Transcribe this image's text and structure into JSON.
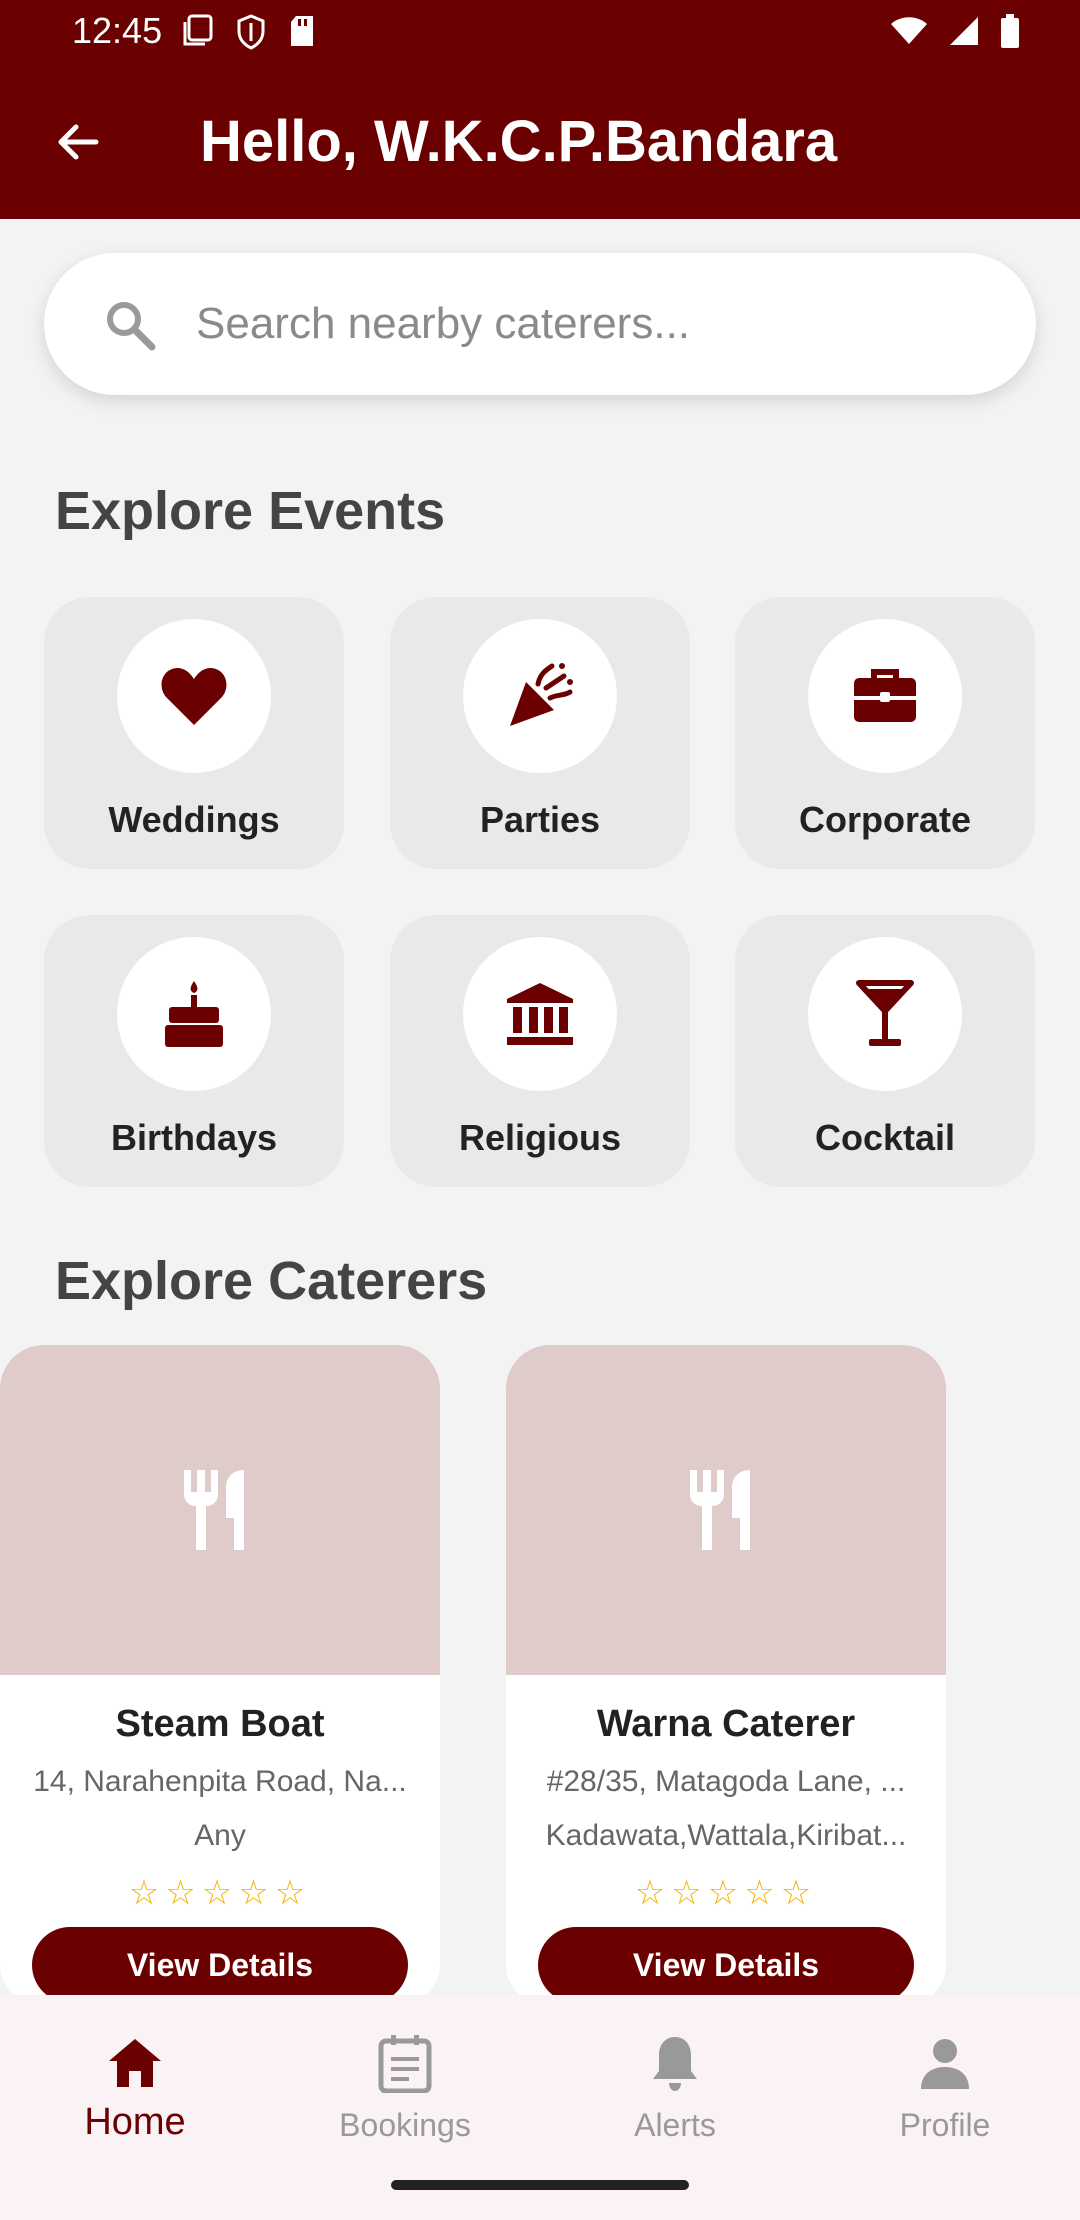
{
  "status_bar": {
    "time": "12:45"
  },
  "header": {
    "title": "Hello, W.K.C.P.Bandara"
  },
  "search": {
    "placeholder": "Search nearby caterers..."
  },
  "sections": {
    "events_title": "Explore Events",
    "caterers_title": "Explore Caterers"
  },
  "events": [
    {
      "label": "Weddings",
      "icon": "heart-icon"
    },
    {
      "label": "Parties",
      "icon": "party-popper-icon"
    },
    {
      "label": "Corporate",
      "icon": "briefcase-icon"
    },
    {
      "label": "Birthdays",
      "icon": "cake-icon"
    },
    {
      "label": "Religious",
      "icon": "temple-icon"
    },
    {
      "label": "Cocktail",
      "icon": "cocktail-icon"
    }
  ],
  "caterers": [
    {
      "name": "Steam Boat",
      "address": "14, Narahenpita Road, Na...",
      "area": "Any",
      "rating": 0,
      "stars": "☆☆☆☆☆",
      "button_label": "View Details"
    },
    {
      "name": "Warna Caterer",
      "address": "#28/35, Matagoda Lane, ...",
      "area": "Kadawata,Wattala,Kiribat...",
      "rating": 0,
      "stars": "☆☆☆☆☆",
      "button_label": "View Details"
    }
  ],
  "bottom_nav": [
    {
      "label": "Home",
      "icon": "home-icon",
      "active": true
    },
    {
      "label": "Bookings",
      "icon": "calendar-icon",
      "active": false
    },
    {
      "label": "Alerts",
      "icon": "bell-icon",
      "active": false
    },
    {
      "label": "Profile",
      "icon": "person-icon",
      "active": false
    }
  ],
  "colors": {
    "primary": "#6b0000",
    "background": "#f3f3f3",
    "star": "#f2b400",
    "card_image": "#e0cbcb"
  }
}
